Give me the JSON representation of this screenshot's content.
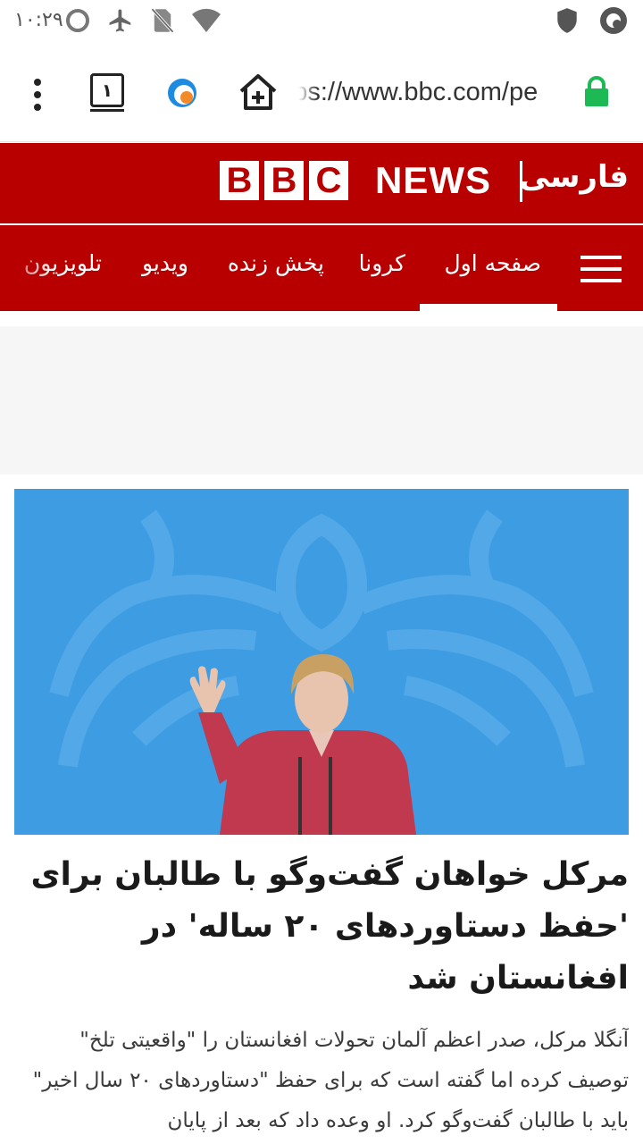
{
  "status_bar": {
    "time": "۱۰:۲۹",
    "icons": [
      "circle-icon",
      "airplane-icon",
      "no-sim-icon",
      "wifi-icon",
      "shield-icon",
      "app-notification-icon"
    ]
  },
  "browser": {
    "tab_count": "۱",
    "url": "https://www.bbc.com/pe",
    "icons": [
      "more-vert-icon",
      "tabs-icon",
      "site-logo-icon",
      "home-icon",
      "lock-icon"
    ]
  },
  "header": {
    "brand_letters": [
      "B",
      "B",
      "C"
    ],
    "news": "NEWS",
    "language": "فارسی"
  },
  "nav": {
    "items": [
      {
        "label": "صفحه اول",
        "active": true
      },
      {
        "label": "کرونا"
      },
      {
        "label": "پخش زنده"
      },
      {
        "label": "ویدیو"
      },
      {
        "label": "تلویزیون"
      }
    ],
    "menu_icon": "hamburger-icon"
  },
  "article": {
    "headline": "مرکل خواهان گفت‌وگو با طالبان برای 'حفظ دستاوردهای ۲۰ ساله' در افغانستان شد",
    "summary": "آنگلا مرکل، صدر اعظم آلمان تحولات افغانستان را \"واقعیتی تلخ\" توصیف کرده اما گفته است که برای حفظ \"دستاوردهای ۲۰ سال اخیر\" باید با طالبان گفت‌وگو کرد. او وعده داد که بعد از پایان"
  },
  "colors": {
    "brand_red": "#b80000",
    "lock_green": "#1db954",
    "hero_blue": "#3e9ce3"
  }
}
